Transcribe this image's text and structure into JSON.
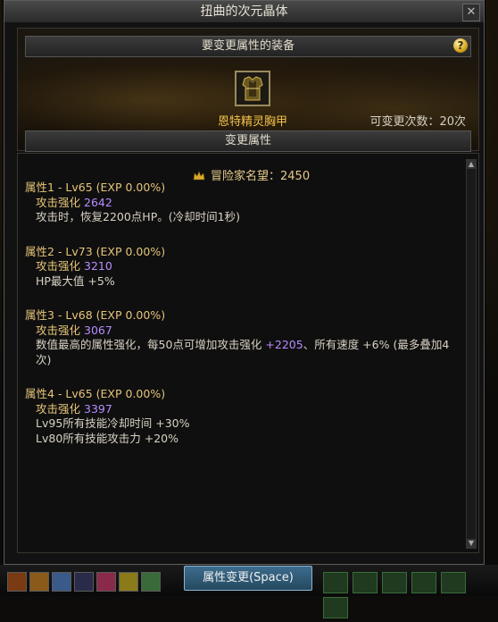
{
  "window": {
    "title": "扭曲的次元晶体"
  },
  "equipment": {
    "header": "要变更属性的装备",
    "item_name": "恩特精灵胸甲",
    "change_count_label": "可变更次数：20次"
  },
  "attributes": {
    "header": "变更属性",
    "reputation": "冒险家名望：2450",
    "items": [
      {
        "title": "属性1 - Lv65 (EXP 0.00%)",
        "sub_label": "攻击强化",
        "sub_value": "2642",
        "lines": [
          "攻击时，恢复2200点HP。(冷却时间1秒)"
        ]
      },
      {
        "title": "属性2 - Lv73 (EXP 0.00%)",
        "sub_label": "攻击强化",
        "sub_value": "3210",
        "lines": [
          "HP最大值 +5%"
        ]
      },
      {
        "title": "属性3 - Lv68 (EXP 0.00%)",
        "sub_label": "攻击强化",
        "sub_value": "3067",
        "line_pre": "数值最高的属性强化，每50点可增加攻击强化 ",
        "line_hl": "+2205",
        "line_post": "、所有速度 +6% (最多叠加4次)"
      },
      {
        "title": "属性4 - Lv65 (EXP 0.00%)",
        "sub_label": "攻击强化",
        "sub_value": "3397",
        "lines": [
          "Lv95所有技能冷却时间 +30%",
          "Lv80所有技能攻击力 +20%"
        ]
      }
    ]
  },
  "button": {
    "label": "属性变更(Space)"
  },
  "icons": {
    "help": "help-icon",
    "close": "close-icon",
    "crown": "crown-icon",
    "armor": "chest-armor-icon"
  },
  "colors": {
    "gold_text": "#e6c47a",
    "item_name": "#f3c24a",
    "purple_value": "#b78cff",
    "button_blue": "#3d6c8d"
  }
}
